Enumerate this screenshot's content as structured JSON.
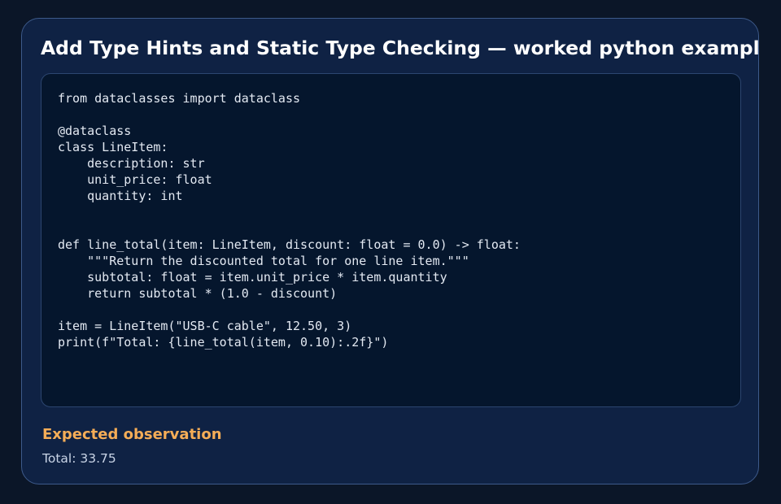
{
  "card": {
    "title": "Add Type Hints and Static Type Checking — worked python example",
    "code": "from dataclasses import dataclass\n\n@dataclass\nclass LineItem:\n    description: str\n    unit_price: float\n    quantity: int\n\n\ndef line_total(item: LineItem, discount: float = 0.0) -> float:\n    \"\"\"Return the discounted total for one line item.\"\"\"\n    subtotal: float = item.unit_price * item.quantity\n    return subtotal * (1.0 - discount)\n\nitem = LineItem(\"USB-C cable\", 12.50, 3)\nprint(f\"Total: {line_total(item, 0.10):.2f}\")",
    "observation_heading": "Expected observation",
    "observation_value": "Total: 33.75"
  },
  "colors": {
    "page_background": "#0b1628",
    "card_background": "#0f2244",
    "code_background": "#05162d",
    "heading_accent": "#f5ad57"
  }
}
